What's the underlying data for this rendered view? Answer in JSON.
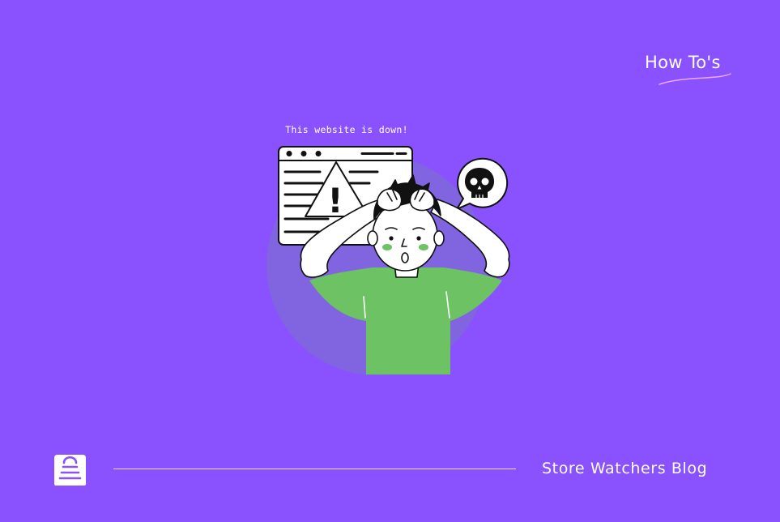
{
  "category": {
    "label": "How To's"
  },
  "illustration": {
    "caption": "This website is down!",
    "warning_glyph": "!"
  },
  "footer": {
    "blog_name": "Store Watchers Blog",
    "logo_icon": "shopping-bag-icon"
  },
  "colors": {
    "background": "#8a52ff",
    "circle": "#8164e0",
    "shirt": "#6dc263",
    "cheeks": "#6dc263",
    "ink": "#111111",
    "white": "#ffffff",
    "accent_line": "#f0a7ff"
  }
}
